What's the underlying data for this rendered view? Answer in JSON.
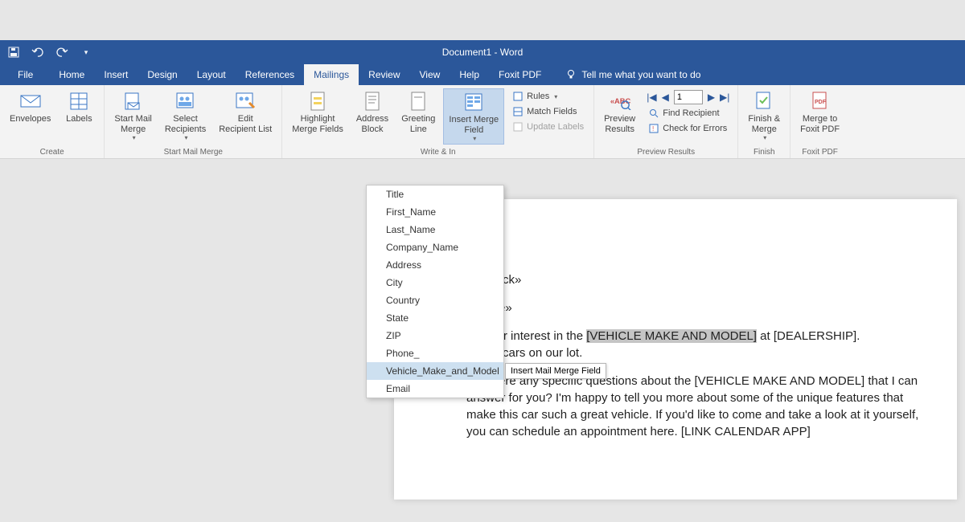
{
  "window": {
    "title": "Document1  -  Word"
  },
  "menu": {
    "file": "File",
    "home": "Home",
    "insert": "Insert",
    "design": "Design",
    "layout": "Layout",
    "references": "References",
    "mailings": "Mailings",
    "review": "Review",
    "view": "View",
    "help": "Help",
    "foxit": "Foxit PDF",
    "tellme": "Tell me what you want to do"
  },
  "ribbon": {
    "create": {
      "envelopes": "Envelopes",
      "labels": "Labels",
      "group": "Create"
    },
    "start": {
      "start_mail_merge": "Start Mail\nMerge",
      "select_recipients": "Select\nRecipients",
      "edit_recipient_list": "Edit\nRecipient List",
      "group": "Start Mail Merge"
    },
    "write": {
      "highlight": "Highlight\nMerge Fields",
      "address_block": "Address\nBlock",
      "greeting_line": "Greeting\nLine",
      "insert_merge_field": "Insert Merge\nField",
      "rules": "Rules",
      "match_fields": "Match Fields",
      "update_labels": "Update Labels",
      "group": "Write & In"
    },
    "preview": {
      "preview_results": "Preview\nResults",
      "record_value": "1",
      "find_recipient": "Find Recipient",
      "check_errors": "Check for Errors",
      "group": "Preview Results"
    },
    "finish": {
      "finish_merge": "Finish &\nMerge",
      "group": "Finish"
    },
    "foxit": {
      "merge_to_pdf": "Merge to\nFoxit PDF",
      "group": "Foxit PDF"
    }
  },
  "dropdown": {
    "items": [
      "Title",
      "First_Name",
      "Last_Name",
      "Company_Name",
      "Address",
      "City",
      "Country",
      "State",
      "ZIP",
      "Phone_",
      "Vehicle_Make_and_Model",
      "Email"
    ],
    "hover_index": 10
  },
  "tooltip": {
    "text": "Insert Mail Merge Field"
  },
  "document": {
    "line1": "essBlock»",
    "line2": "ingLine»",
    "para1_a": " for your interest in the ",
    "para1_hl": "[VEHICLE MAKE AND MODEL]",
    "para1_b": " at [DEALERSHIP].",
    "para1_c": "e best cars on our lot.",
    "para2": "Are there any specific questions about the [VEHICLE MAKE AND MODEL] that I can answer for you? I'm happy to tell you more about some of the unique features that make this car such a great vehicle. If you'd like to come and take a look at it yourself, you can schedule an appointment here. [LINK CALENDAR APP]"
  }
}
